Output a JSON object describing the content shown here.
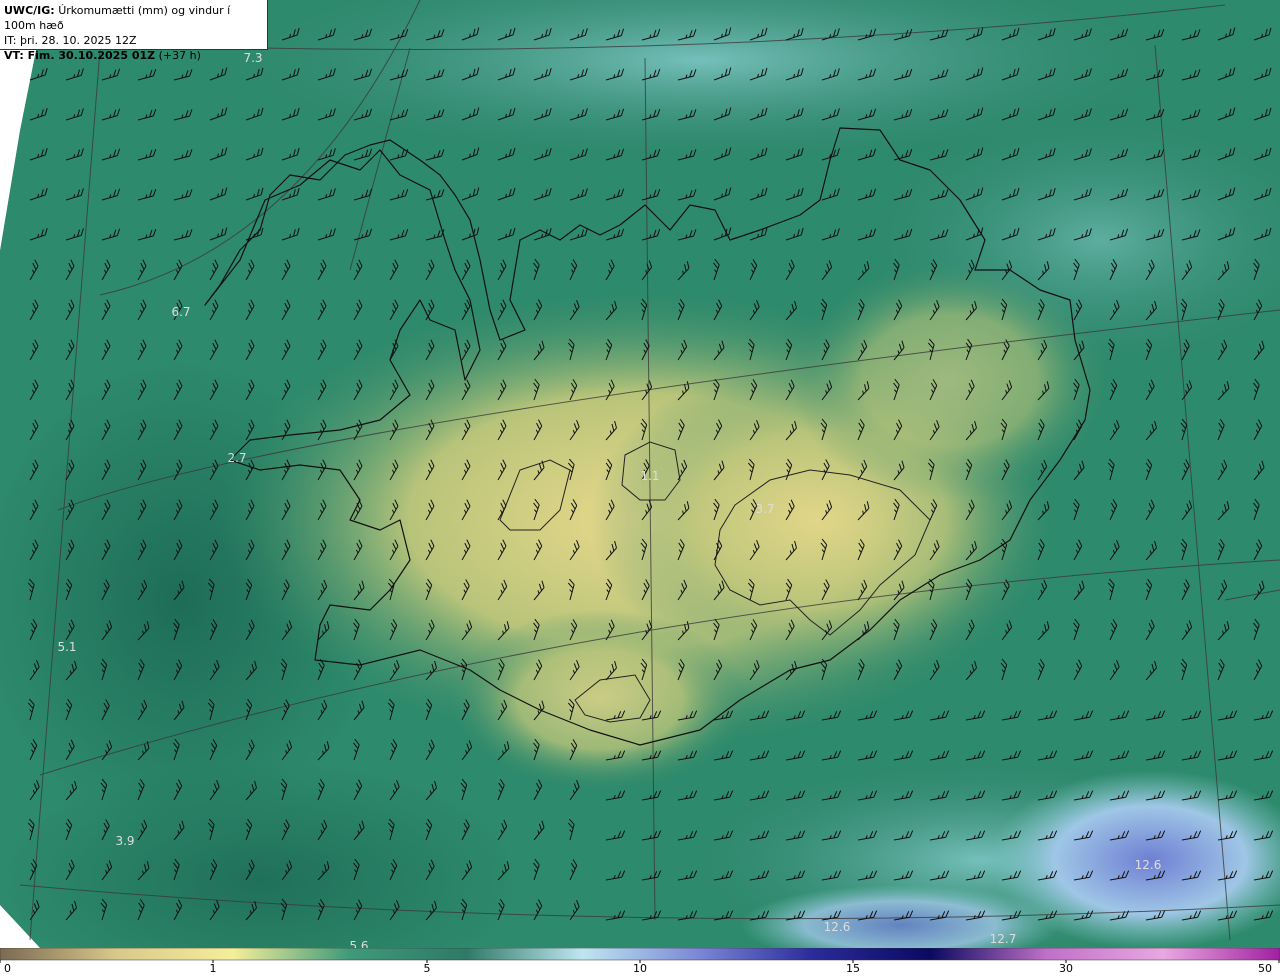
{
  "header": {
    "model": "UWC/IG:",
    "title": "Úrkomumætti (mm) og vindur í 100m hæð",
    "init_time": "IT: þri. 28. 10. 2025 12Z",
    "valid_time": "VT: Fim. 30.10.2025 01Z",
    "lead": "(+37 h)"
  },
  "map_labels": [
    "7.3",
    "6.7",
    "2.7",
    "5.1",
    "3.9",
    "5.6",
    "1.1",
    "3.7",
    "12.6",
    "12.6",
    "12.7"
  ],
  "colorbar": {
    "ticks": [
      "0",
      "1",
      "5",
      "10",
      "15",
      "30",
      "50"
    ],
    "colors": [
      "#7a6a52",
      "#d8c98a",
      "#f5ee9a",
      "#3f9a7a",
      "#2e7a66",
      "#bfe6f0",
      "#7b88d6",
      "#2a2a9a",
      "#0a0a60",
      "#c070c8",
      "#e8a8e0",
      "#a020a0"
    ]
  },
  "colors": {
    "field_land_low": "#e8da88",
    "field_mid": "#2f8a6e",
    "field_sea_dark": "#1f6e58",
    "field_sea_light": "#5fb0a8",
    "field_high": "#7f8fd8",
    "coast": "#111111",
    "graticule": "#3a3a3a",
    "barb": "#111111",
    "label": "#dddddd"
  }
}
